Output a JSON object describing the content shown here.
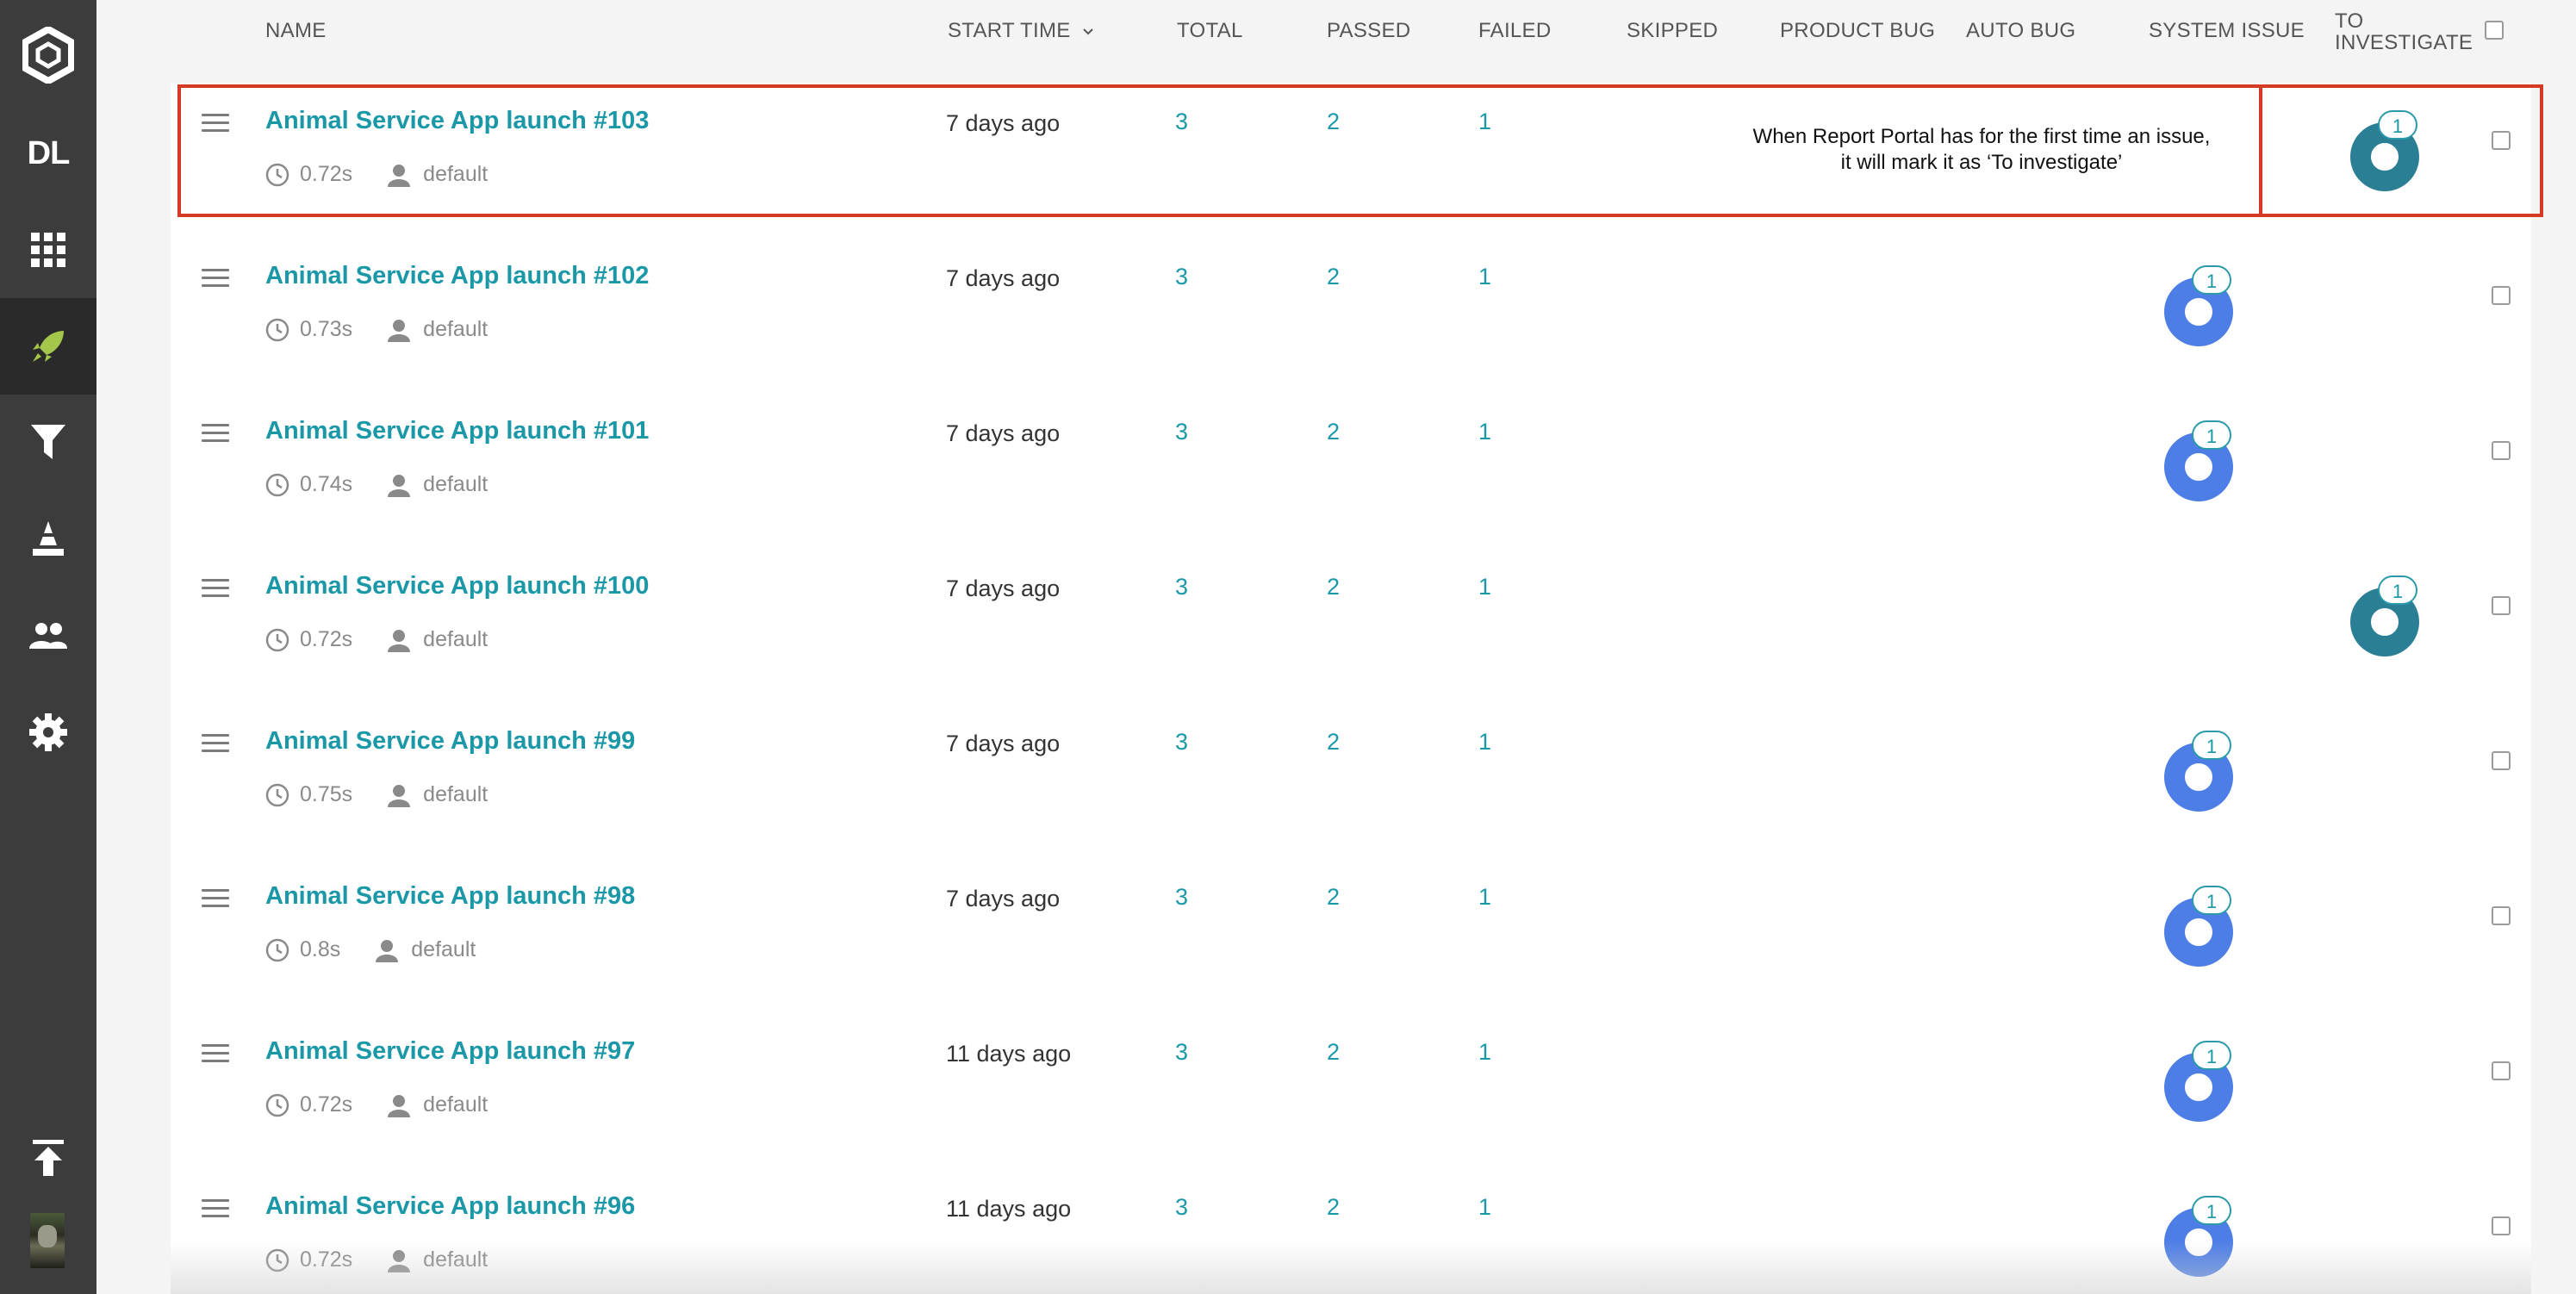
{
  "sidebar": {
    "project_badge": "DL",
    "icons": [
      "logo-icon",
      "dashboard-icon",
      "launches-icon",
      "filters-icon",
      "debug-icon",
      "members-icon",
      "settings-icon",
      "scroll-top-icon"
    ]
  },
  "header": {
    "name": "NAME",
    "start_time": "START TIME",
    "total": "TOTAL",
    "passed": "PASSED",
    "failed": "FAILED",
    "skipped": "SKIPPED",
    "product_bug": "PRODUCT BUG",
    "auto_bug": "AUTO BUG",
    "system_issue": "SYSTEM ISSUE",
    "to_investigate_1": "TO",
    "to_investigate_2": "INVESTIGATE"
  },
  "annotation": {
    "line1": "When Report Portal has for the first time an issue,",
    "line2": "it will mark it as ‘To investigate’"
  },
  "colors": {
    "accent": "#1a98a8",
    "system_issue": "#4d7ee6",
    "to_investigate": "#2a7f94",
    "annotation": "#d53a22"
  },
  "launches": [
    {
      "name": "Animal Service App launch #103",
      "duration": "0.72s",
      "owner": "default",
      "start": "7 days ago",
      "total": "3",
      "passed": "2",
      "failed": "1",
      "defect": "to_investigate",
      "defect_count": "1"
    },
    {
      "name": "Animal Service App launch #102",
      "duration": "0.73s",
      "owner": "default",
      "start": "7 days ago",
      "total": "3",
      "passed": "2",
      "failed": "1",
      "defect": "system_issue",
      "defect_count": "1"
    },
    {
      "name": "Animal Service App launch #101",
      "duration": "0.74s",
      "owner": "default",
      "start": "7 days ago",
      "total": "3",
      "passed": "2",
      "failed": "1",
      "defect": "system_issue",
      "defect_count": "1"
    },
    {
      "name": "Animal Service App launch #100",
      "duration": "0.72s",
      "owner": "default",
      "start": "7 days ago",
      "total": "3",
      "passed": "2",
      "failed": "1",
      "defect": "to_investigate",
      "defect_count": "1"
    },
    {
      "name": "Animal Service App launch #99",
      "duration": "0.75s",
      "owner": "default",
      "start": "7 days ago",
      "total": "3",
      "passed": "2",
      "failed": "1",
      "defect": "system_issue",
      "defect_count": "1"
    },
    {
      "name": "Animal Service App launch #98",
      "duration": "0.8s",
      "owner": "default",
      "start": "7 days ago",
      "total": "3",
      "passed": "2",
      "failed": "1",
      "defect": "system_issue",
      "defect_count": "1"
    },
    {
      "name": "Animal Service App launch #97",
      "duration": "0.72s",
      "owner": "default",
      "start": "11 days ago",
      "total": "3",
      "passed": "2",
      "failed": "1",
      "defect": "system_issue",
      "defect_count": "1"
    },
    {
      "name": "Animal Service App launch #96",
      "duration": "0.72s",
      "owner": "default",
      "start": "11 days ago",
      "total": "3",
      "passed": "2",
      "failed": "1",
      "defect": "system_issue",
      "defect_count": "1"
    }
  ]
}
